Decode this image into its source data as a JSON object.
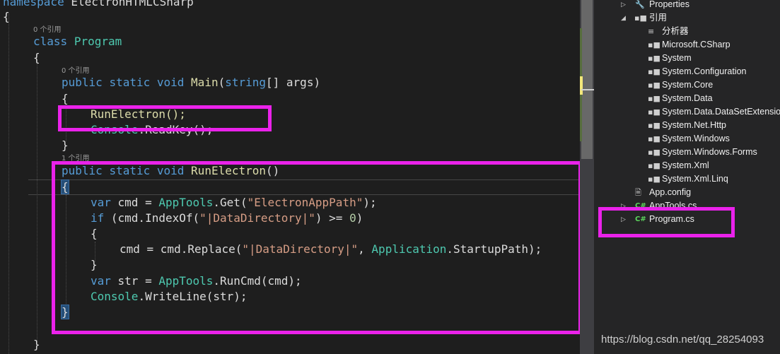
{
  "editor": {
    "lines": {
      "namespace_kw": "namespace",
      "namespace_name": "ElectronHTMLCSharp",
      "open_ns": "{",
      "class_kw": "class",
      "class_name": "Program",
      "open_class": "{",
      "main_sig": {
        "public": "public",
        "static": "static",
        "void": "void",
        "name": "Main",
        "paren_open": "(",
        "string": "string",
        "rest": "[] args)"
      },
      "open_main": "{",
      "call_run": "RunElectron();",
      "console1_type": "Console",
      "console1_rest": ".ReadKey();",
      "close_main": "}",
      "run_sig": {
        "public": "public",
        "static": "static",
        "void": "void",
        "name": "RunElectron",
        "parens": "()"
      },
      "open_run": "{",
      "var_cmd": {
        "var": "var",
        "mid": " cmd = ",
        "type": "AppTools",
        "method": ".Get(",
        "str": "\"ElectronAppPath\"",
        "end": ");"
      },
      "if_line": {
        "if": "if",
        "mid": " (cmd.IndexOf(",
        "str": "\"|DataDirectory|\"",
        "op": ") >= ",
        "num": "0",
        "end": ")"
      },
      "open_if": "{",
      "replace_line": {
        "start": "cmd = cmd.Replace(",
        "str": "\"|DataDirectory|\"",
        "comma": ", ",
        "type": "Application",
        "end": ".StartupPath);"
      },
      "close_if": "}",
      "var_str": {
        "var": "var",
        "mid": " str = ",
        "type": "AppTools",
        "end": ".RunCmd(cmd);"
      },
      "writeline": {
        "type": "Console",
        "end": ".WriteLine(str);"
      },
      "close_run": "}",
      "close_class": "}"
    },
    "refs": {
      "class_refs": "0 个引用",
      "main_refs": "0 个引用",
      "run_refs": "1 个引用"
    }
  },
  "solution_explorer": {
    "items": [
      {
        "label": "Properties",
        "icon": "wrench-icon"
      },
      {
        "label": "引用",
        "icon": "references-icon"
      },
      {
        "label": "分析器",
        "icon": "analyzer-icon"
      },
      {
        "label": "Microsoft.CSharp",
        "icon": "reference-icon"
      },
      {
        "label": "System",
        "icon": "reference-icon"
      },
      {
        "label": "System.Configuration",
        "icon": "reference-icon"
      },
      {
        "label": "System.Core",
        "icon": "reference-icon"
      },
      {
        "label": "System.Data",
        "icon": "reference-icon"
      },
      {
        "label": "System.Data.DataSetExtensions",
        "icon": "reference-icon"
      },
      {
        "label": "System.Net.Http",
        "icon": "reference-icon"
      },
      {
        "label": "System.Windows",
        "icon": "reference-icon"
      },
      {
        "label": "System.Windows.Forms",
        "icon": "reference-icon"
      },
      {
        "label": "System.Xml",
        "icon": "reference-icon"
      },
      {
        "label": "System.Xml.Linq",
        "icon": "reference-icon"
      },
      {
        "label": "App.config",
        "icon": "config-file-icon"
      },
      {
        "label": "AppTools.cs",
        "icon": "csharp-file-icon"
      },
      {
        "label": "Program.cs",
        "icon": "csharp-file-icon"
      }
    ],
    "csharp_glyph": "C#"
  },
  "watermark": "https://blog.csdn.net/qq_28254093",
  "colors": {
    "highlight": "#ea22ea",
    "keyword": "#569cd6",
    "type": "#4ec9b0",
    "string": "#d69d85",
    "number": "#b5cea8",
    "method": "#dcdcaa"
  }
}
